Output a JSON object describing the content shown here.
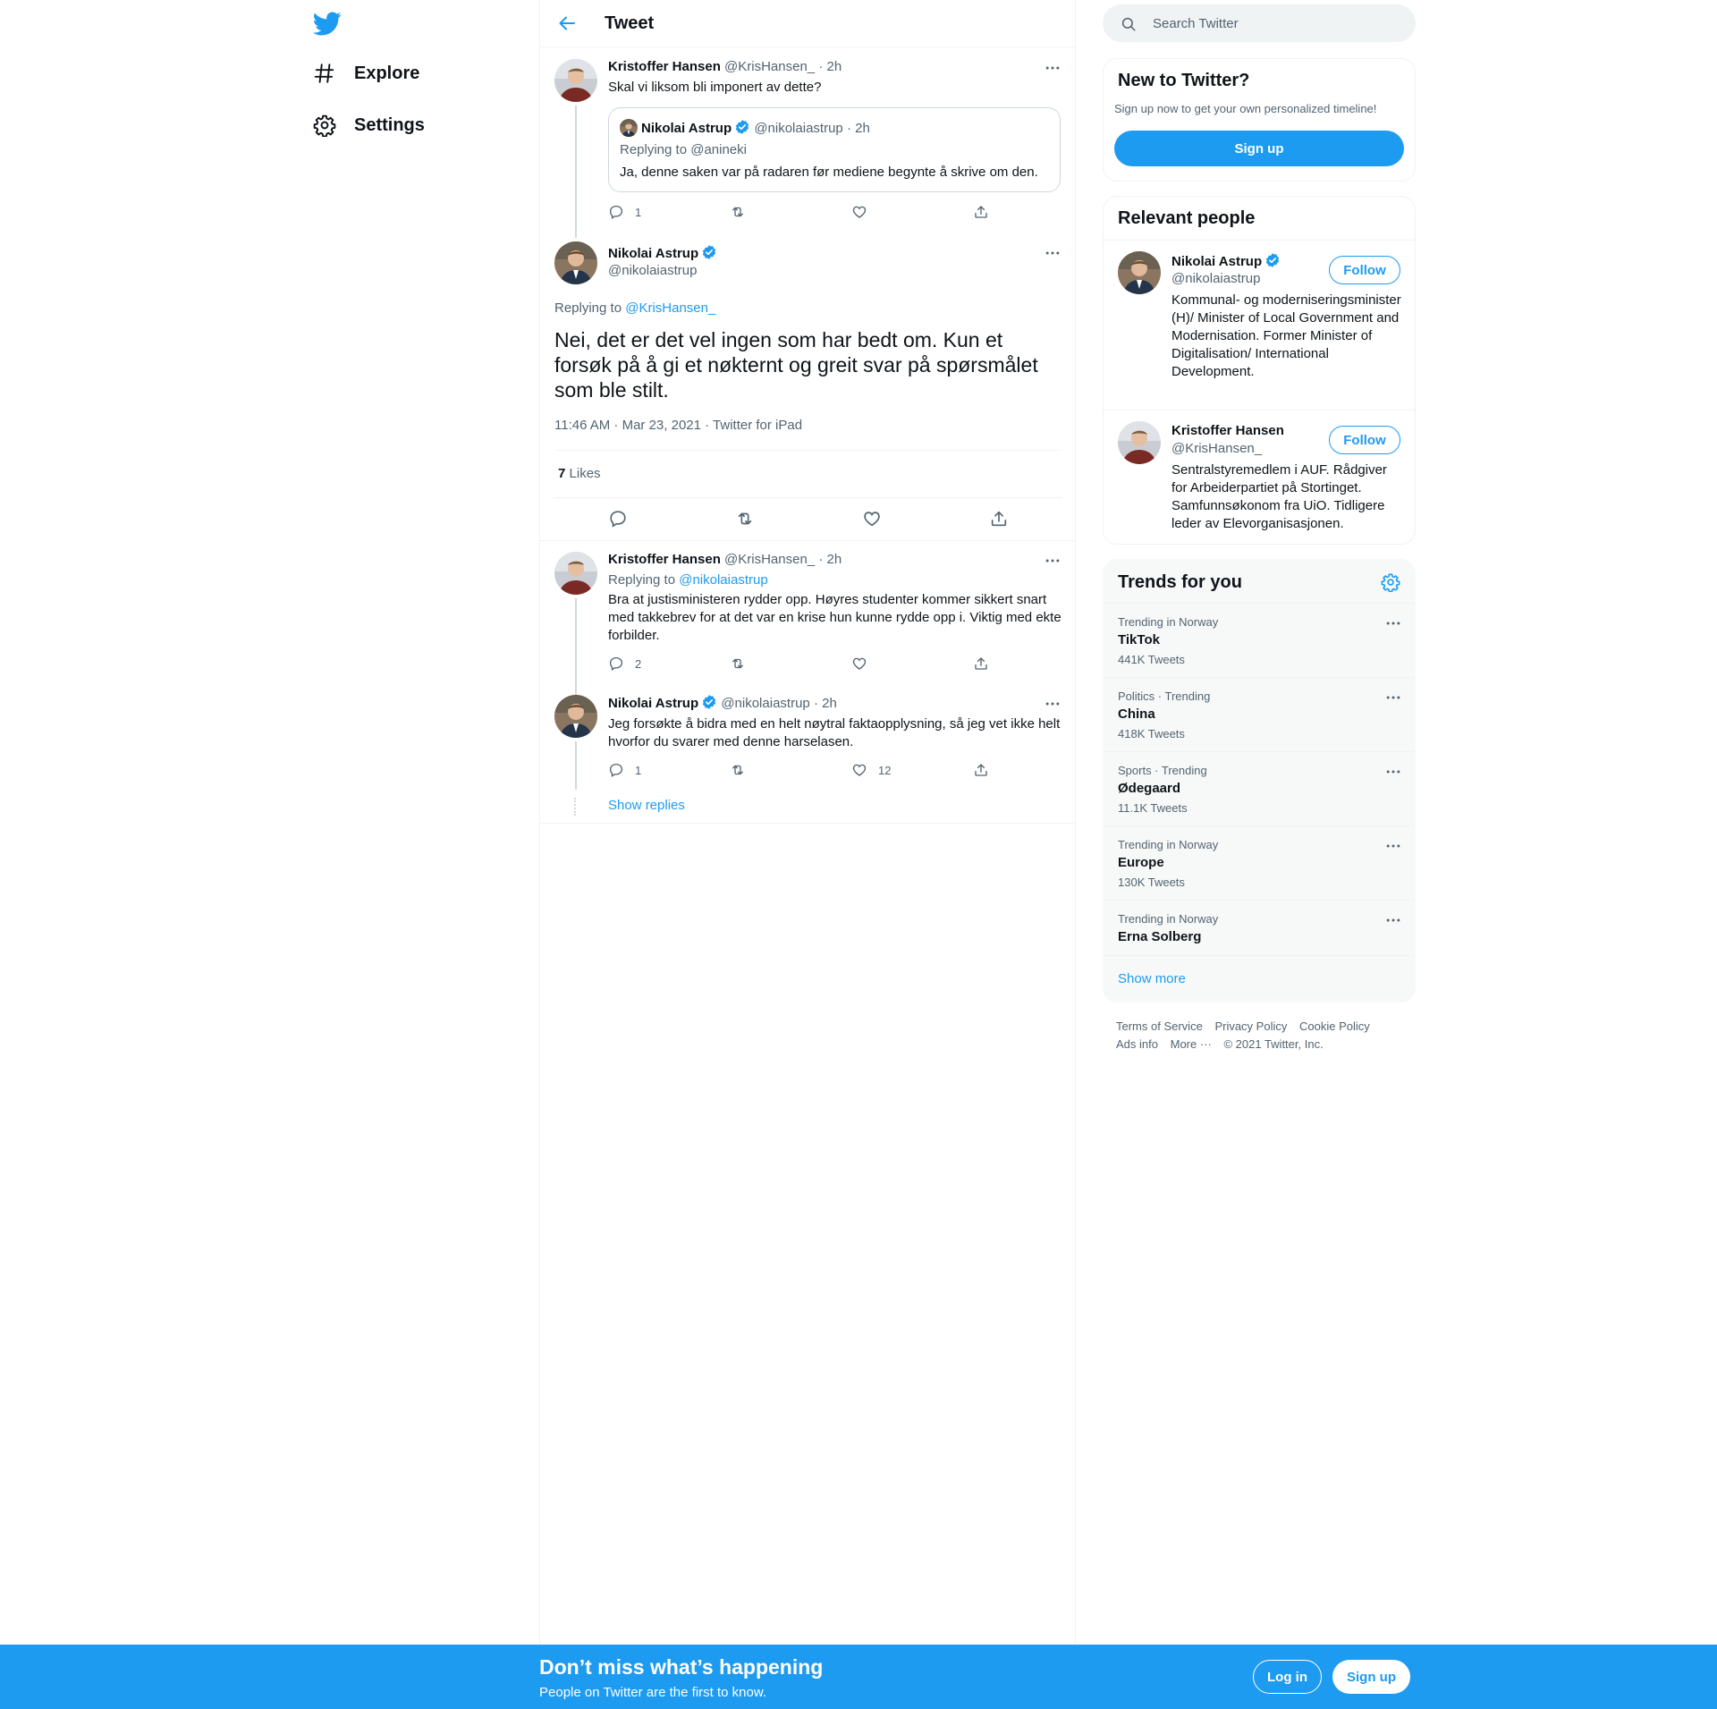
{
  "nav": {
    "explore": "Explore",
    "settings": "Settings"
  },
  "header": {
    "title": "Tweet"
  },
  "tweet1": {
    "name": "Kristoffer Hansen",
    "handle": "@KrisHansen_",
    "time": "· 2h",
    "text": "Skal vi liksom bli imponert av dette?",
    "quote": {
      "name": "Nikolai Astrup",
      "handle": "@nikolaiastrup",
      "time": "· 2h",
      "replying_prefix": "Replying to ",
      "replying_to": "@anineki",
      "text": "Ja, denne saken var på radaren før mediene begynte å skrive om den."
    },
    "replies": "1"
  },
  "main_tweet": {
    "name": "Nikolai Astrup",
    "handle": "@nikolaiastrup",
    "replying_prefix": "Replying to ",
    "replying_to": "@KrisHansen_",
    "text": "Nei, det er det vel ingen som har bedt om. Kun et forsøk på å gi et nøkternt og greit svar på spørsmålet som ble stilt.",
    "timestamp": "11:46 AM · Mar 23, 2021 · Twitter for iPad",
    "likes_count": "7",
    "likes_label": "Likes"
  },
  "reply1": {
    "name": "Kristoffer Hansen",
    "handle": "@KrisHansen_",
    "time": "· 2h",
    "replying_prefix": "Replying to ",
    "replying_to": "@nikolaiastrup",
    "text": "Bra at justisministeren rydder opp. Høyres studenter kommer sikkert snart med takkebrev for at det var en krise hun kunne rydde opp i. Viktig med ekte forbilder.",
    "replies": "2"
  },
  "reply2": {
    "name": "Nikolai Astrup",
    "handle": "@nikolaiastrup",
    "time": "· 2h",
    "text": "Jeg forsøkte å bidra med en helt nøytral faktaopplysning, så jeg vet ikke helt hvorfor du svarer med denne harselasen.",
    "replies": "1",
    "likes": "12"
  },
  "show_replies": "Show replies",
  "search": {
    "placeholder": "Search Twitter"
  },
  "new_to_twitter": {
    "title": "New to Twitter?",
    "subtitle": "Sign up now to get your own personalized timeline!",
    "signup": "Sign up"
  },
  "relevant": {
    "title": "Relevant people",
    "people": [
      {
        "name": "Nikolai Astrup",
        "handle": "@nikolaiastrup",
        "follow": "Follow",
        "bio": "Kommunal- og moderniseringsminister (H)/ Minister of Local Government and Modernisation. Former Minister of Digitalisation/ International Development."
      },
      {
        "name": "Kristoffer Hansen",
        "handle": "@KrisHansen_",
        "follow": "Follow",
        "bio": "Sentralstyremedlem i AUF. Rådgiver for Arbeiderpartiet på Stortinget. Samfunnsøkonom fra UiO. Tidligere leder av Elevorganisasjonen."
      }
    ]
  },
  "trends": {
    "title": "Trends for you",
    "items": [
      {
        "context": "Trending in Norway",
        "name": "TikTok",
        "count": "441K Tweets"
      },
      {
        "context": "Politics · Trending",
        "name": "China",
        "count": "418K Tweets"
      },
      {
        "context": "Sports · Trending",
        "name": "Ødegaard",
        "count": "11.1K Tweets"
      },
      {
        "context": "Trending in Norway",
        "name": "Europe",
        "count": "130K Tweets"
      },
      {
        "context": "Trending in Norway",
        "name": "Erna Solberg",
        "count": ""
      }
    ],
    "show_more": "Show more"
  },
  "footer": {
    "terms": "Terms of Service",
    "privacy": "Privacy Policy",
    "cookie": "Cookie Policy",
    "ads": "Ads info",
    "more": "More ···",
    "copyright": "© 2021 Twitter, Inc."
  },
  "banner": {
    "title": "Don’t miss what’s happening",
    "subtitle": "People on Twitter are the first to know.",
    "login": "Log in",
    "signup": "Sign up"
  },
  "colors": {
    "accent": "#1d9bf0",
    "text": "#0f1419",
    "muted": "#536471"
  },
  "icons": [
    "twitter-bird-icon",
    "hashtag-icon",
    "gear-icon",
    "back-arrow-icon",
    "verified-icon",
    "reply-icon",
    "retweet-icon",
    "like-icon",
    "share-icon",
    "more-icon",
    "search-icon"
  ]
}
